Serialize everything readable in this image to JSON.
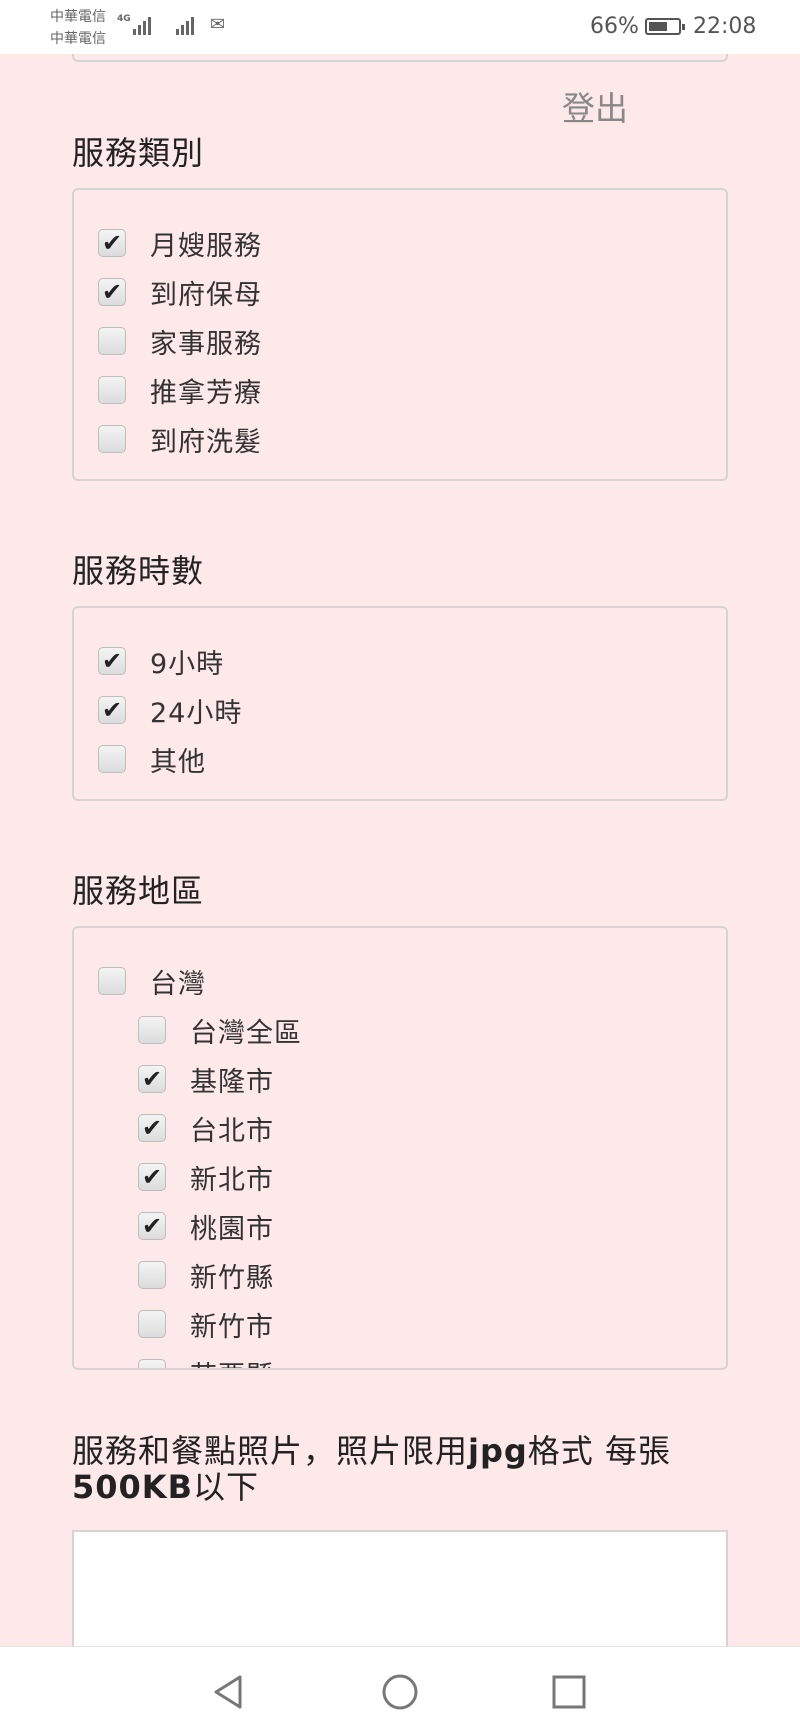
{
  "status_bar": {
    "carrier_1": "中華電信",
    "carrier_2": "中華電信",
    "network": "4G",
    "battery_percent": "66%",
    "battery_level": 0.66,
    "time": "22:08",
    "icons": [
      "signal-icon",
      "signal-icon",
      "mail-icon",
      "battery-icon"
    ]
  },
  "header": {
    "logout_label": "登出"
  },
  "service_category": {
    "title": "服務類別",
    "options": [
      {
        "label": "月嫂服務",
        "checked": true
      },
      {
        "label": "到府保母",
        "checked": true
      },
      {
        "label": "家事服務",
        "checked": false
      },
      {
        "label": "推拿芳療",
        "checked": false
      },
      {
        "label": "到府洗髮",
        "checked": false
      }
    ]
  },
  "service_hours": {
    "title": "服務時數",
    "options": [
      {
        "label": "9小時",
        "checked": true
      },
      {
        "label": "24小時",
        "checked": true
      },
      {
        "label": "其他",
        "checked": false
      }
    ]
  },
  "service_region": {
    "title": "服務地區",
    "parent": {
      "label": "台灣",
      "checked": false
    },
    "options": [
      {
        "label": "台灣全區",
        "checked": false
      },
      {
        "label": "基隆市",
        "checked": true
      },
      {
        "label": "台北市",
        "checked": true
      },
      {
        "label": "新北市",
        "checked": true
      },
      {
        "label": "桃園市",
        "checked": true
      },
      {
        "label": "新竹縣",
        "checked": false
      },
      {
        "label": "新竹市",
        "checked": false
      },
      {
        "label": "苗栗縣",
        "checked": false
      }
    ]
  },
  "photos": {
    "title_part1": "服務和餐點照片，照片限用",
    "title_bold1": "jpg",
    "title_part2": "格式 每張",
    "title_bold2": "500KB",
    "title_part3": "以下"
  },
  "nav_bar": {
    "icons": [
      "back-icon",
      "home-icon",
      "recents-icon"
    ]
  }
}
